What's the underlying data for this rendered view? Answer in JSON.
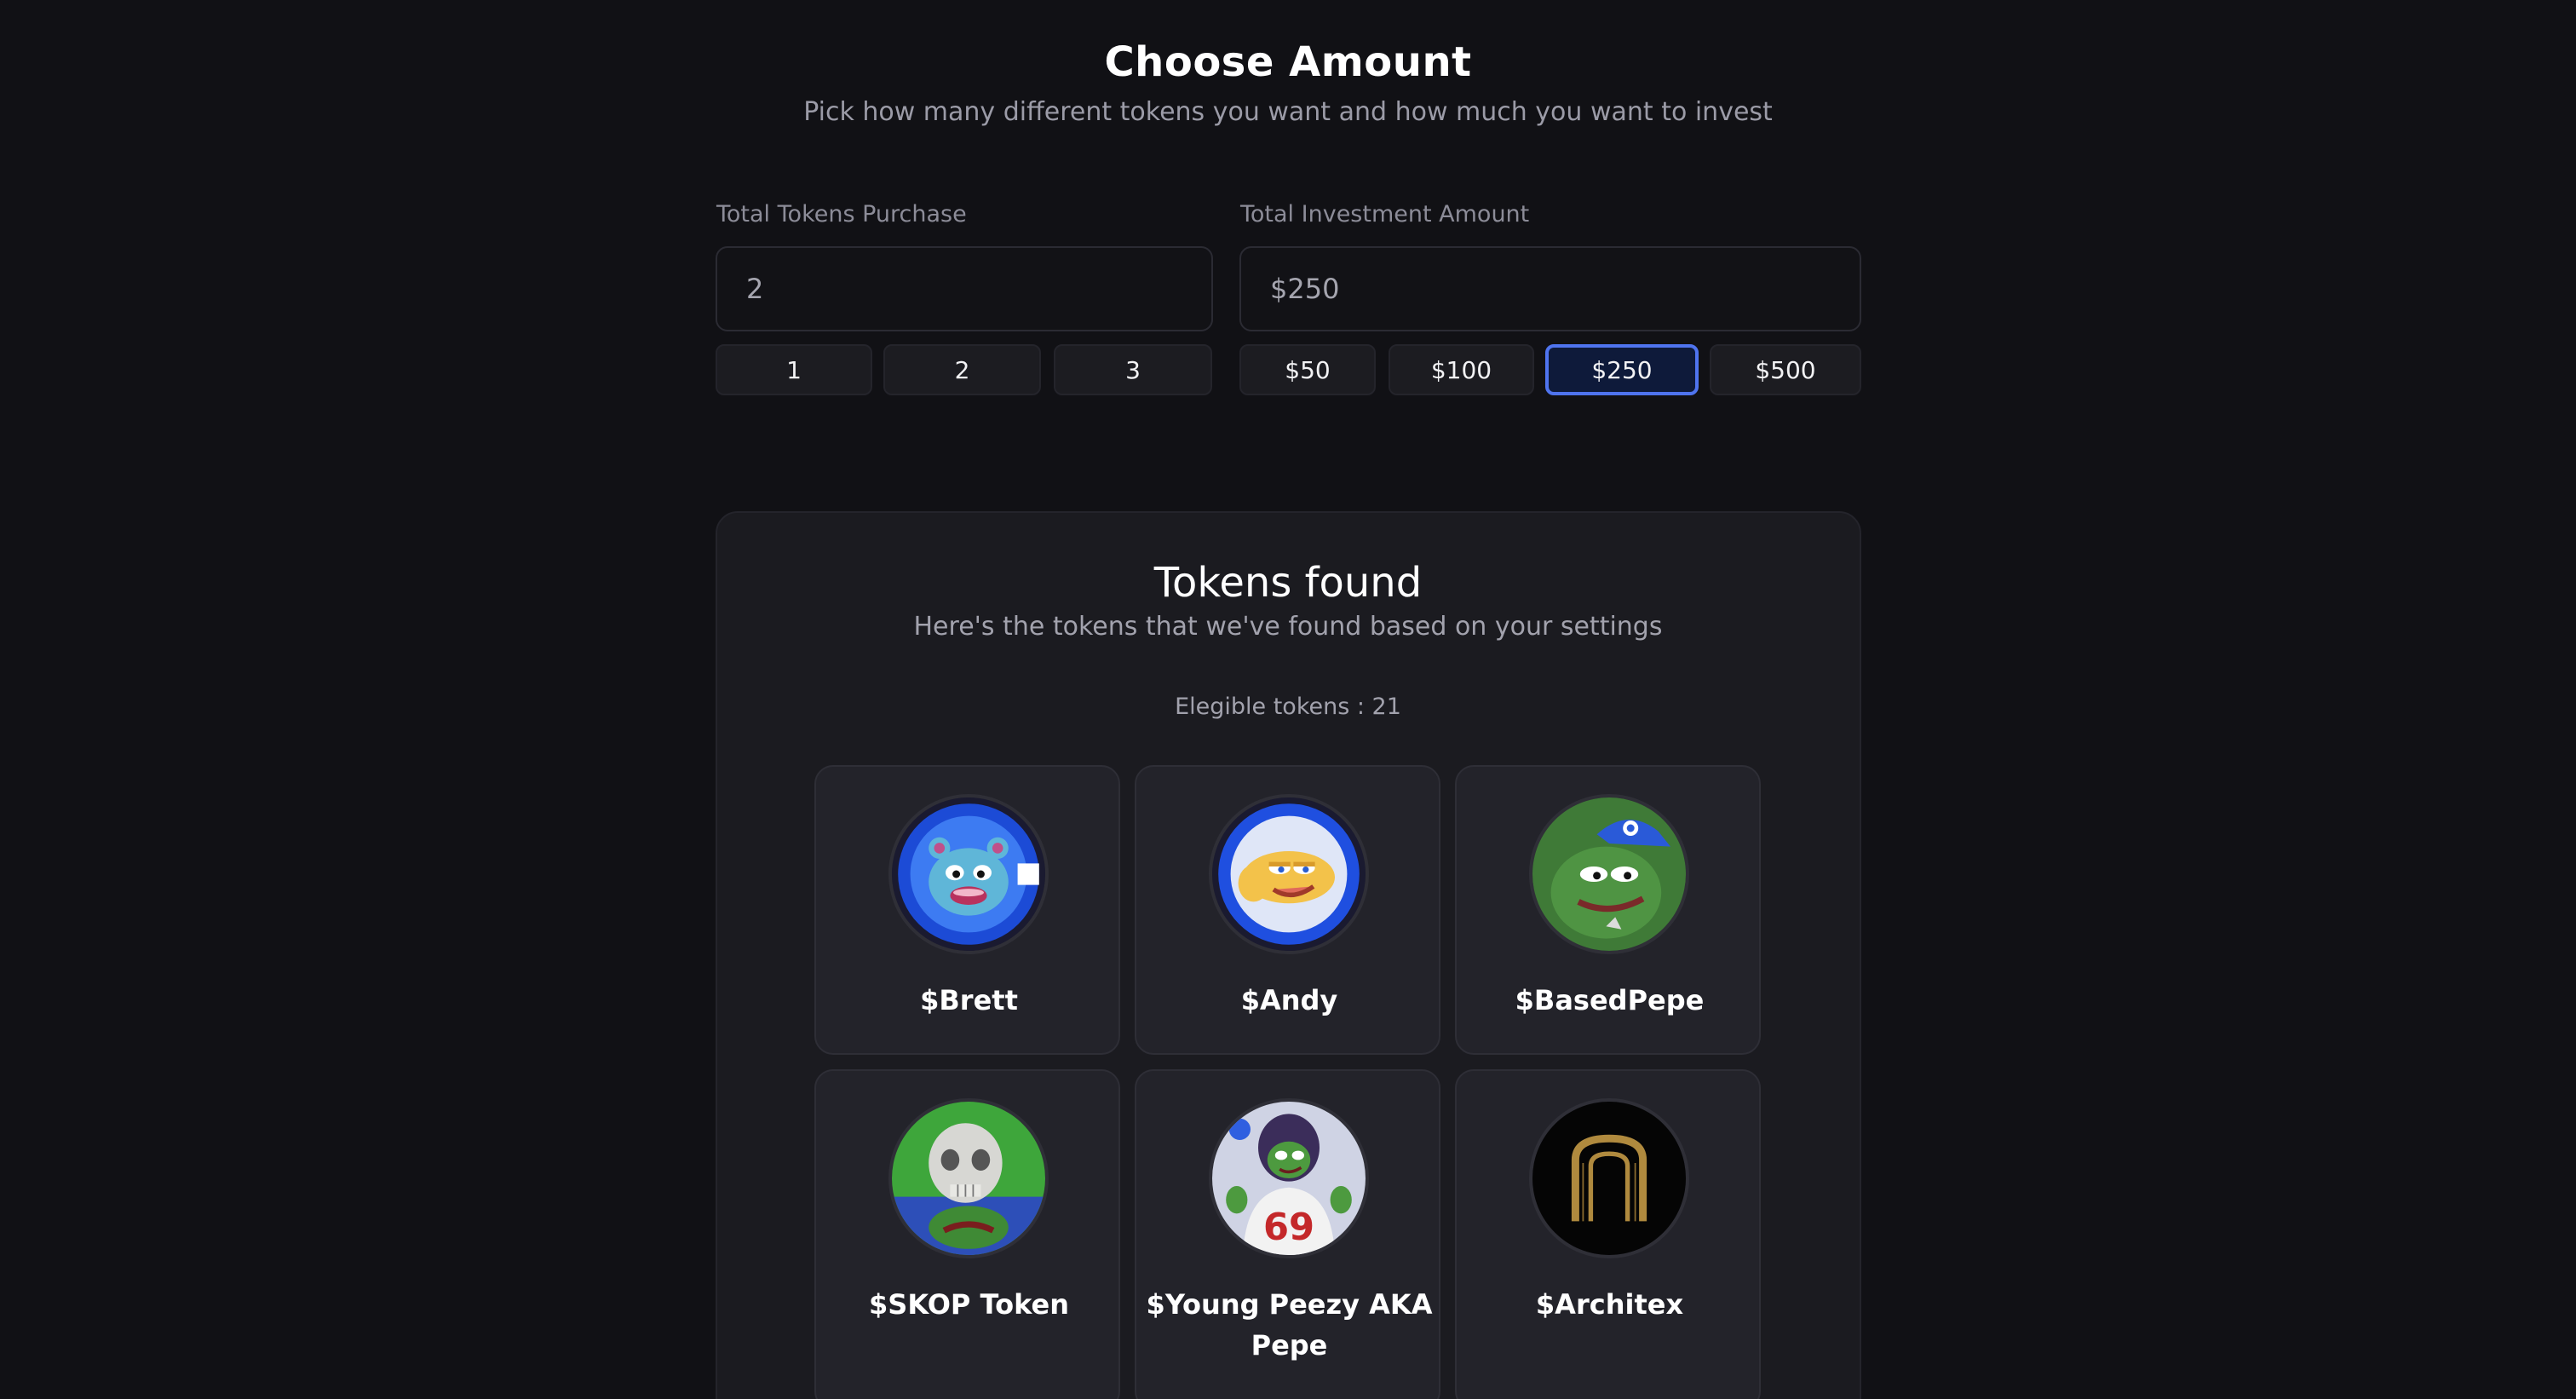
{
  "header": {
    "title": "Choose Amount",
    "subtitle": "Pick how many different tokens you want and how much you want to invest"
  },
  "tokens_count": {
    "label": "Total Tokens Purchase",
    "value": "2",
    "options": [
      "1",
      "2",
      "3"
    ]
  },
  "investment": {
    "label": "Total Investment Amount",
    "value": "$250",
    "options": [
      "$50",
      "$100",
      "$250",
      "$500"
    ],
    "selected": "$250"
  },
  "results": {
    "title": "Tokens found",
    "subtitle": "Here's the tokens that we've found based on your settings",
    "eligible": "Elegible tokens : 21",
    "tokens": [
      {
        "name": "$Brett",
        "icon": "brett-avatar-icon"
      },
      {
        "name": "$Andy",
        "icon": "andy-avatar-icon"
      },
      {
        "name": "$BasedPepe",
        "icon": "basedpepe-avatar-icon"
      },
      {
        "name": "$SKOP Token",
        "icon": "skop-avatar-icon"
      },
      {
        "name": "$Young Peezy AKA Pepe",
        "icon": "young-peezy-avatar-icon"
      },
      {
        "name": "$Architex",
        "icon": "architex-avatar-icon"
      }
    ]
  },
  "colors": {
    "background": "#111115",
    "panel": "#1b1b20",
    "card": "#23232a",
    "accent": "#4f74ef"
  }
}
